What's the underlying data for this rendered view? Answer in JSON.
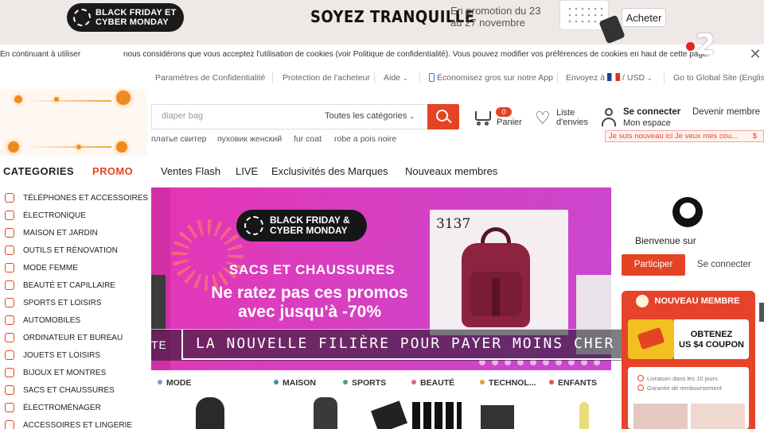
{
  "promo_banner": {
    "event_line1": "BLACK FRIDAY ET",
    "event_line2": "CYBER MONDAY",
    "headline": "SOYEZ TRANQUILLE",
    "dates_line1": "En promotion du 23",
    "dates_line2": "au 27 novembre",
    "buy_button": "Acheter"
  },
  "cookie_notice": {
    "part1": "En continuant à utiliser",
    "part2": "nous considérons que vous acceptez l'utilisation de cookies (voir Politique de confidentialité). Vous pouvez modifier vos préférences de cookies en haut de cette page.",
    "close_icon": "close-icon"
  },
  "tv_overlay_logo": "2",
  "util_nav": {
    "privacy": "Paramètres de Confidentialité",
    "buyer_protection": "Protection de l'acheteur",
    "help": "Aide",
    "app": "Économisez gros sur notre App",
    "ship_to": "Envoyez à",
    "currency": "USD",
    "global": "Go to Global Site (English)"
  },
  "search": {
    "value": "diaper bag",
    "category": "Toutes les catégories",
    "suggestions": [
      "платье свитер",
      "пуховик женский",
      "fur coat",
      "robe a pois noire"
    ]
  },
  "header": {
    "cart_count": "0",
    "cart_label": "Panier",
    "wishlist_line1": "Liste",
    "wishlist_line2": "d'envies",
    "signin": "Se connecter",
    "my_space": "Mon espace",
    "become_member": "Devenir membre",
    "newbie_strip": "Je suis nouveau ici Je veux mes cou...",
    "newbie_strip_end": "$"
  },
  "sidebar": {
    "categories_label": "CATEGORIES",
    "promo_label": "PROMO",
    "items": [
      "TÉLÉPHONES ET ACCESSOIRES",
      "ÉLECTRONIQUE",
      "MAISON ET JARDIN",
      "OUTILS ET RÉNOVATION",
      "MODE FEMME",
      "BEAUTÉ ET CAPILLAIRE",
      "SPORTS ET LOISIRS",
      "AUTOMOBILES",
      "ORDINATEUR ET BUREAU",
      "JOUETS ET LOISIRS",
      "BIJOUX ET MONTRES",
      "SACS ET CHAUSSURES",
      "ÉLECTROMÉNAGER",
      "ACCESSOIRES ET LINGERIE"
    ]
  },
  "main_tabs": [
    "Ventes Flash",
    "LIVE",
    "Exclusivités des Marques",
    "Nouveaux membres"
  ],
  "hero": {
    "event_line1": "BLACK FRIDAY &",
    "event_line2": "CYBER MONDAY",
    "subtitle": "SACS ET CHAUSSURES",
    "headline_line1": "Ne ratez pas ces promos",
    "headline_line2": "avec jusqu'à -70%",
    "product_code": "3137"
  },
  "tv_subtitle": {
    "left_label": "TE",
    "title": "LA NOUVELLE FILIÈRE POUR PAYER MOINS CHER"
  },
  "category_tabs": [
    {
      "label": "MODE",
      "color": "#7a9cd6"
    },
    {
      "label": "MAISON",
      "color": "#3f8fa6"
    },
    {
      "label": "SPORTS",
      "color": "#4aa36b"
    },
    {
      "label": "BEAUTÉ",
      "color": "#d86b8a"
    },
    {
      "label": "TECHNOL...",
      "color": "#e2a13a"
    },
    {
      "label": "ENFANTS",
      "color": "#e45a3a"
    }
  ],
  "user_panel": {
    "welcome": "Bienvenue sur",
    "join_button": "Participer",
    "login_link": "Se connecter"
  },
  "new_member": {
    "title": "NOUVEAU MEMBRE",
    "coupon_line1": "OBTENEZ",
    "coupon_line2": "US $4 COUPON",
    "delivery": "Livraison dans les 10 jours",
    "refund": "Garantie de remboursement"
  },
  "colors": {
    "accent": "#e44424",
    "hero_bg": "#e534b4"
  }
}
